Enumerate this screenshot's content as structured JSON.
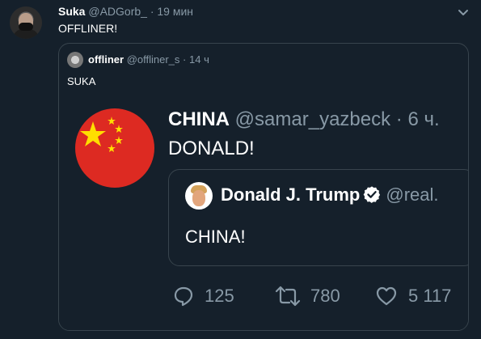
{
  "tweet": {
    "author_name": "Suka",
    "author_handle": "@ADGorb_",
    "separator": "·",
    "time": "19 мин",
    "text": "OFFLINER!"
  },
  "quote": {
    "author_name": "offliner",
    "author_handle": "@offliner_s",
    "separator": "·",
    "time": "14 ч",
    "text": "SUKA"
  },
  "embedded": {
    "author_name": "CHINA",
    "author_handle": "@samar_yazbeck",
    "separator": "·",
    "time": "6 ч.",
    "text": "DONALD!",
    "inner": {
      "author_name": "Donald J. Trump",
      "author_handle": "@real.",
      "text": "CHINA!"
    },
    "actions": {
      "replies": "125",
      "retweets": "780",
      "likes": "5 117"
    }
  },
  "icons": {
    "more": "more-icon",
    "verified": "verified-icon",
    "reply": "reply-icon",
    "retweet": "retweet-icon",
    "like": "like-icon"
  },
  "colors": {
    "background": "#15202b",
    "border": "#38444d",
    "muted_text": "#8899a6",
    "flag_red": "#dd2a22",
    "flag_yellow": "#ffde00",
    "verified_blue": "#ffffff"
  }
}
